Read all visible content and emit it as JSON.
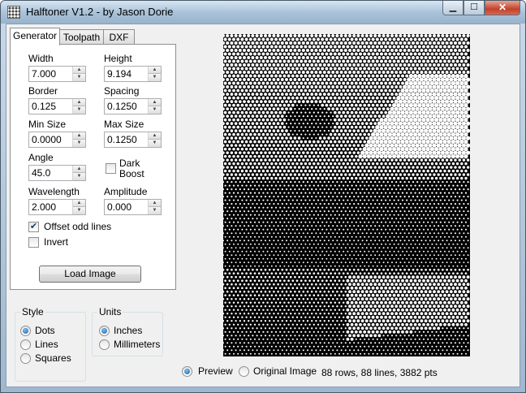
{
  "window": {
    "title": "Halftoner V1.2 - by Jason Dorie"
  },
  "tabs": [
    {
      "label": "Generator",
      "active": true
    },
    {
      "label": "Toolpath",
      "active": false
    },
    {
      "label": "DXF",
      "active": false
    }
  ],
  "fields": {
    "width": {
      "label": "Width",
      "value": "7.000"
    },
    "height": {
      "label": "Height",
      "value": "9.194"
    },
    "border": {
      "label": "Border",
      "value": "0.125"
    },
    "spacing": {
      "label": "Spacing",
      "value": "0.1250"
    },
    "min_size": {
      "label": "Min Size",
      "value": "0.0000"
    },
    "max_size": {
      "label": "Max Size",
      "value": "0.1250"
    },
    "angle": {
      "label": "Angle",
      "value": "45.0"
    },
    "wavelength": {
      "label": "Wavelength",
      "value": "2.000"
    },
    "amplitude": {
      "label": "Amplitude",
      "value": "0.000"
    }
  },
  "checkboxes": {
    "dark_boost": {
      "label_line1": "Dark",
      "label_line2": "Boost",
      "checked": false
    },
    "offset_odd_lines": {
      "label": "Offset odd lines",
      "checked": true
    },
    "invert": {
      "label": "Invert",
      "checked": false
    }
  },
  "load_image_button": "Load Image",
  "style_group": {
    "title": "Style",
    "options": [
      {
        "label": "Dots",
        "selected": true
      },
      {
        "label": "Lines",
        "selected": false
      },
      {
        "label": "Squares",
        "selected": false
      }
    ]
  },
  "units_group": {
    "title": "Units",
    "options": [
      {
        "label": "Inches",
        "selected": true
      },
      {
        "label": "Millimeters",
        "selected": false
      }
    ]
  },
  "view": {
    "preview": {
      "label": "Preview",
      "selected": true
    },
    "original": {
      "label": "Original Image",
      "selected": false
    }
  },
  "status": "88 rows, 88 lines, 3882 pts",
  "colors": {
    "preview_bg": "#000000",
    "dot": "#ffffff"
  }
}
